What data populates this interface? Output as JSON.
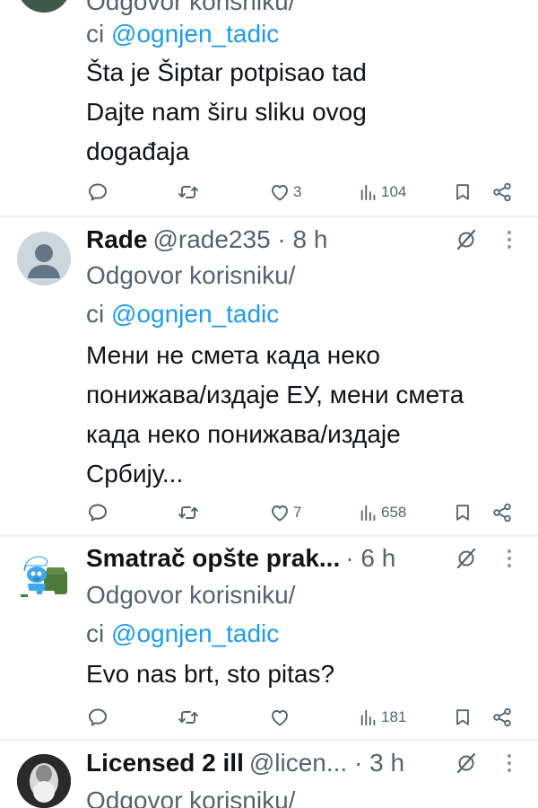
{
  "tweets": [
    {
      "name": "",
      "reply_label": "Odgovor korisniku/",
      "reply_prefix": "ci",
      "reply_mention": "@ognjen_tadic",
      "lines": [
        "Šta je Šiptar potpisao tad",
        "Dajte nam širu sliku ovog",
        "događaja"
      ],
      "replies": "",
      "retweets": "",
      "likes": "3",
      "views": "104"
    },
    {
      "name": "Rade",
      "meta": "@rade235 · 8 h",
      "reply_label": "Odgovor korisniku/",
      "reply_prefix": "ci",
      "reply_mention": "@ognjen_tadic",
      "lines": [
        "Мени не смета када неко",
        "понижава/издаје ЕУ, мени смета",
        "када неко понижава/издаје",
        "Србију..."
      ],
      "replies": "",
      "retweets": "",
      "likes": "7",
      "views": "658"
    },
    {
      "name": "Smatrač opšte prak...",
      "meta": "· 6 h",
      "reply_label": "Odgovor korisniku/",
      "reply_prefix": "ci",
      "reply_mention": "@ognjen_tadic",
      "lines": [
        "Evo nas brt, sto pitas?"
      ],
      "replies": "",
      "retweets": "",
      "likes": "",
      "views": "181"
    },
    {
      "name": "Licensed 2 ill",
      "meta": "@licen... · 3 h",
      "reply_label": "Odgovor korisniku/"
    }
  ],
  "icons": {
    "reply": "comment-icon",
    "retweet": "retweet-icon",
    "like": "heart-icon",
    "views": "views-icon",
    "bookmark": "bookmark-icon",
    "share": "share-icon",
    "grok": "grok-icon",
    "more": "more-vertical-icon"
  },
  "colors": {
    "mention": "#1d9bf0",
    "secondary": "#536471",
    "text": "#0f1419"
  }
}
